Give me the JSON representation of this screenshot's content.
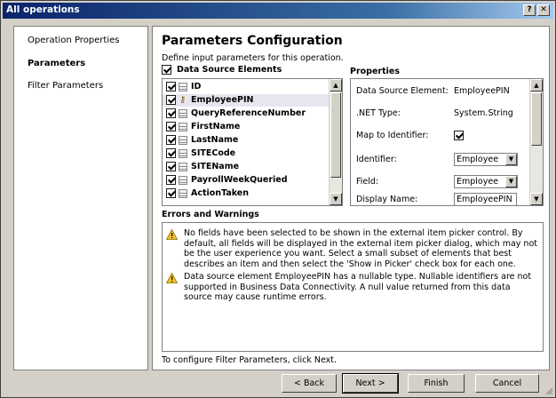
{
  "window": {
    "title": "All operations",
    "help_btn": "?",
    "close_btn": "✕"
  },
  "nav": {
    "items": [
      {
        "label": "Operation Properties",
        "active": false
      },
      {
        "label": "Parameters",
        "active": true
      },
      {
        "label": "Filter Parameters",
        "active": false
      }
    ]
  },
  "main": {
    "title": "Parameters Configuration",
    "subtitle": "Define input parameters for this operation.",
    "dse_label": "Data Source Elements",
    "props_label": "Properties",
    "elements": [
      {
        "name": "ID",
        "checked": true,
        "icon": "table-icon"
      },
      {
        "name": "EmployeePIN",
        "checked": true,
        "icon": "key-icon",
        "selected": true
      },
      {
        "name": "QueryReferenceNumber",
        "checked": true,
        "icon": "table-icon"
      },
      {
        "name": "FirstName",
        "checked": true,
        "icon": "table-icon"
      },
      {
        "name": "LastName",
        "checked": true,
        "icon": "table-icon"
      },
      {
        "name": "SITECode",
        "checked": true,
        "icon": "table-icon"
      },
      {
        "name": "SITEName",
        "checked": true,
        "icon": "table-icon"
      },
      {
        "name": "PayrollWeekQueried",
        "checked": true,
        "icon": "table-icon"
      },
      {
        "name": "ActionTaken",
        "checked": true,
        "icon": "table-icon"
      }
    ],
    "properties": {
      "data_source_element": {
        "label": "Data Source Element:",
        "value": "EmployeePIN"
      },
      "net_type": {
        "label": ".NET Type:",
        "value": "System.String"
      },
      "map_to_identifier": {
        "label": "Map to Identifier:",
        "checked": true
      },
      "identifier": {
        "label": "Identifier:",
        "value": "Employee"
      },
      "field": {
        "label": "Field:",
        "value": "Employee"
      },
      "display_name": {
        "label": "Display Name:",
        "value": "EmployeePIN"
      }
    },
    "errors_label": "Errors and Warnings",
    "errors": [
      "No fields have been selected to be shown in the external item picker control. By default, all fields will be displayed in the external item picker dialog, which may not be the user experience you want. Select a small subset of elements that best describes an item and then select the 'Show in Picker' check box for each one.",
      "Data source element EmployeePIN has a nullable type. Nullable identifiers are not supported in Business Data Connectivity. A null value returned from this data source may cause runtime errors."
    ],
    "footnote": "To configure Filter Parameters, click Next."
  },
  "buttons": {
    "back": "< Back",
    "next": "Next >",
    "finish": "Finish",
    "cancel": "Cancel"
  },
  "colors": {
    "title_bar": "#0a246a",
    "dialog_bg": "#d4d0c8",
    "selected_row": "#e7e6ef",
    "warning": "#f2c12e"
  }
}
